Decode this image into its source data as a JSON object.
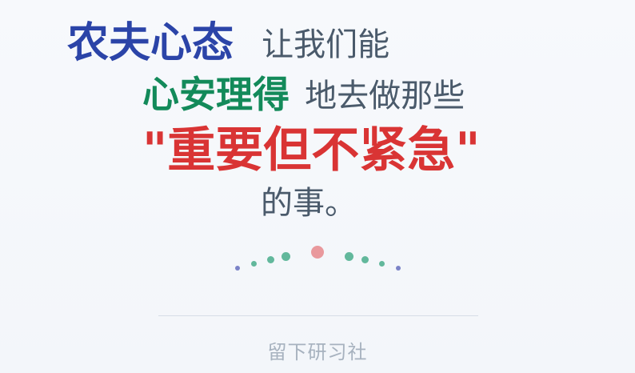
{
  "text": {
    "line1": {
      "emphasis": "农夫心态",
      "rest": "让我们能"
    },
    "line2": {
      "emphasis": "心安理得",
      "rest": "地去做那些"
    },
    "line3": {
      "emphasis": "\"重要但不紧急\""
    },
    "line4": {
      "rest": "的事。"
    }
  },
  "footer": {
    "brand": "留下研习社"
  },
  "colors": {
    "blue": "#2b44a8",
    "green": "#138a5a",
    "red": "#d93434",
    "text": "#4a5a6b",
    "muted": "#a7b2bf",
    "dotPink": "#e9999d",
    "dotGreen": "#62b89c",
    "dotPurple": "#7b83c7"
  }
}
